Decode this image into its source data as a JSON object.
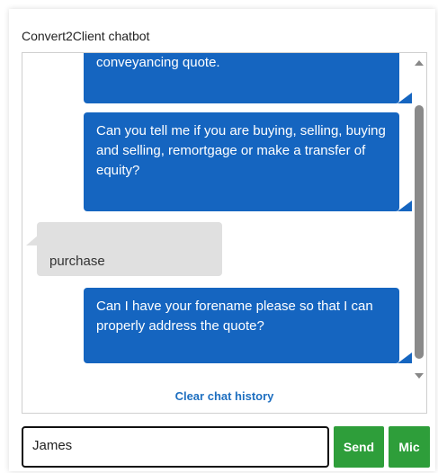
{
  "widget": {
    "title": "Convert2Client chatbot"
  },
  "messages": [
    {
      "sender": "bot",
      "text": "conveyancing quote."
    },
    {
      "sender": "bot",
      "text": "Can you tell me if you are buying, selling, buying and selling, remortgage or make a transfer of equity?"
    },
    {
      "sender": "user",
      "text": "purchase"
    },
    {
      "sender": "bot",
      "text": "Can I have your forename please so that I can properly address the quote?"
    }
  ],
  "clear_history_label": "Clear chat history",
  "input": {
    "value": "James",
    "placeholder": ""
  },
  "buttons": {
    "send_label": "Send",
    "mic_label": "Mic"
  },
  "colors": {
    "bot_bubble": "#1565c0",
    "user_bubble": "#e0e0e0",
    "button_green": "#2e9e3a",
    "link_blue": "#1e6fc0"
  }
}
